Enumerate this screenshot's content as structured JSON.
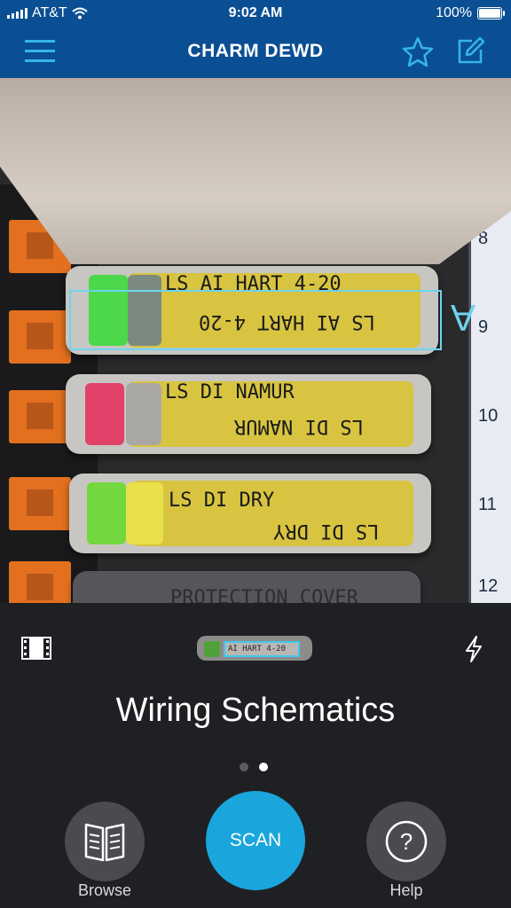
{
  "status_bar": {
    "carrier": "AT&T",
    "time": "9:02 AM",
    "battery": "100%",
    "icons": [
      "signal-icon",
      "wifi-icon",
      "battery-icon"
    ]
  },
  "nav": {
    "title": "CHARM DEWD",
    "icons": [
      "menu-icon",
      "star-icon",
      "edit-icon"
    ]
  },
  "camera": {
    "modules": [
      {
        "label_top": "LS AI HART 4-20",
        "label_bottom": "LS AI HART 4-20",
        "led": "green"
      },
      {
        "label_top": "LS DI NAMUR",
        "label_bottom": "LS DI NAMUR",
        "led": "red"
      },
      {
        "label_top": "LS DI DRY",
        "label_bottom": "LS DI DRY",
        "led": "green-yellow"
      },
      {
        "label_top": "PROTECTION COVER"
      }
    ],
    "panel_numbers": [
      "8",
      "9",
      "10",
      "11",
      "12"
    ],
    "marker": "A"
  },
  "toolbar": {
    "thumbnail_label": "AI HART 4-20",
    "icons": [
      "film-strip-icon",
      "flash-icon"
    ]
  },
  "main": {
    "title": "Wiring Schematics",
    "page_count": 2,
    "active_page": 2
  },
  "actions": {
    "browse_label": "Browse",
    "scan_label": "SCAN",
    "help_label": "Help",
    "help_symbol": "?"
  },
  "colors": {
    "nav_bg": "#0a4f93",
    "accent": "#1aa6dc",
    "selection": "#6fd3ee",
    "background": "#1f2023"
  }
}
